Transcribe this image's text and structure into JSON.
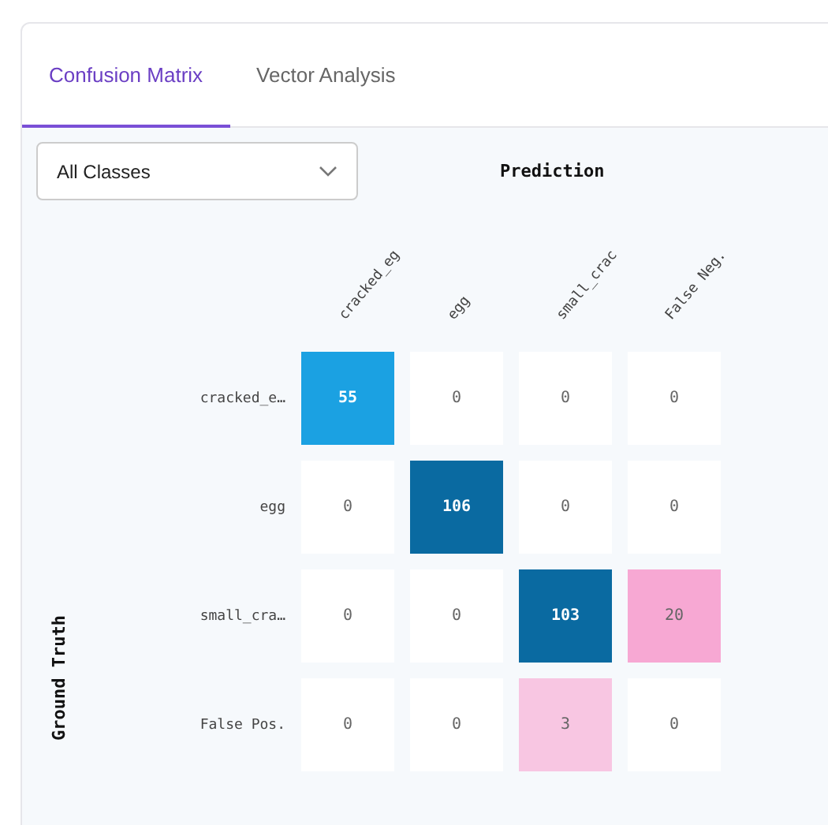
{
  "tabs": [
    {
      "label": "Confusion Matrix",
      "selected": true
    },
    {
      "label": "Vector Analysis",
      "selected": false
    }
  ],
  "class_select": {
    "value": "All Classes"
  },
  "matrix": {
    "x_title": "Prediction",
    "y_title": "Ground Truth",
    "columns": [
      "cracked_eg",
      "egg",
      "small_crac",
      "False Neg."
    ],
    "rows": [
      {
        "label": "cracked_e…",
        "cells": [
          {
            "value": "55",
            "color": "#1ba1e2"
          },
          {
            "value": "0",
            "color": "#ffffff"
          },
          {
            "value": "0",
            "color": "#ffffff"
          },
          {
            "value": "0",
            "color": "#ffffff"
          }
        ]
      },
      {
        "label": "egg",
        "cells": [
          {
            "value": "0",
            "color": "#ffffff"
          },
          {
            "value": "106",
            "color": "#0a6aa1"
          },
          {
            "value": "0",
            "color": "#ffffff"
          },
          {
            "value": "0",
            "color": "#ffffff"
          }
        ]
      },
      {
        "label": "small_cra…",
        "cells": [
          {
            "value": "0",
            "color": "#ffffff"
          },
          {
            "value": "0",
            "color": "#ffffff"
          },
          {
            "value": "103",
            "color": "#0a6aa1"
          },
          {
            "value": "20",
            "color": "#f7a8d3"
          }
        ]
      },
      {
        "label": "False Pos.",
        "cells": [
          {
            "value": "0",
            "color": "#ffffff"
          },
          {
            "value": "0",
            "color": "#ffffff"
          },
          {
            "value": "3",
            "color": "#f8c6e2"
          },
          {
            "value": "0",
            "color": "#ffffff"
          }
        ]
      }
    ]
  }
}
